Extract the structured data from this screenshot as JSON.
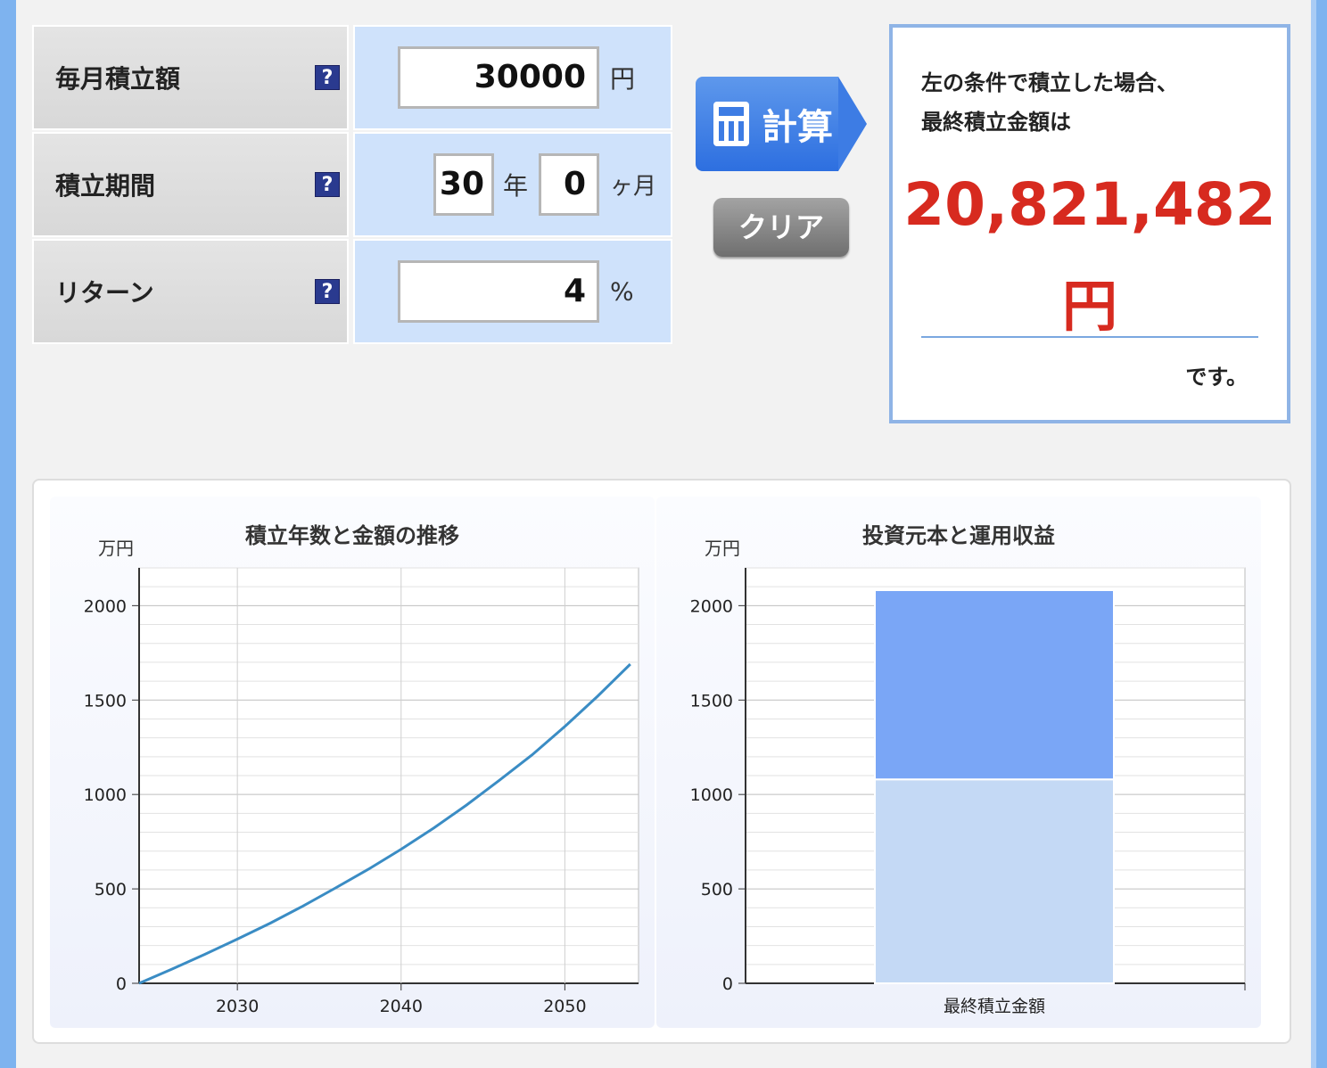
{
  "form": {
    "monthly": {
      "label": "毎月積立額",
      "help": "?",
      "value": "30000",
      "unit": "円"
    },
    "period": {
      "label": "積立期間",
      "help": "?",
      "years": "30",
      "years_unit": "年",
      "months": "0",
      "months_unit": "ヶ月"
    },
    "return": {
      "label": "リターン",
      "help": "?",
      "value": "4",
      "unit": "%"
    }
  },
  "buttons": {
    "calculate": "計算",
    "clear": "クリア"
  },
  "result": {
    "intro_line1": "左の条件で積立した場合、",
    "intro_line2": "最終積立金額は",
    "amount": "20,821,482",
    "currency": "円",
    "outro": "です。"
  },
  "colors": {
    "accent_blue": "#3d7ce4",
    "result_red": "#d72a1f",
    "line": "#3a8cc4",
    "bar_profit": "#7aa6f6",
    "bar_principal": "#c4d9f5"
  },
  "chart_data": [
    {
      "type": "line",
      "title": "積立年数と金額の推移",
      "ylabel": "万円",
      "xlabel": "",
      "x_ticks": [
        "2030",
        "2040",
        "2050"
      ],
      "xlim": [
        2024,
        2054.5
      ],
      "ylim": [
        0,
        2200
      ],
      "y_ticks": [
        "0",
        "500",
        "1000",
        "1500",
        "2000"
      ],
      "grid": true,
      "x": [
        2024,
        2026,
        2028,
        2030,
        2032,
        2034,
        2036,
        2038,
        2040,
        2042,
        2044,
        2046,
        2048,
        2050,
        2052,
        2054
      ],
      "y": [
        0,
        75,
        153,
        234,
        318,
        409,
        505,
        604,
        710,
        823,
        944,
        1075,
        1210,
        1360,
        1520,
        1690
      ]
    },
    {
      "type": "bar",
      "stacked": true,
      "title": "投資元本と運用収益",
      "ylabel": "万円",
      "categories": [
        "最終積立金額"
      ],
      "y_ticks": [
        "0",
        "500",
        "1000",
        "1500",
        "2000"
      ],
      "ylim": [
        0,
        2200
      ],
      "grid": true,
      "series": [
        {
          "values": [
            1080
          ]
        },
        {
          "values": [
            1002
          ]
        }
      ]
    }
  ]
}
